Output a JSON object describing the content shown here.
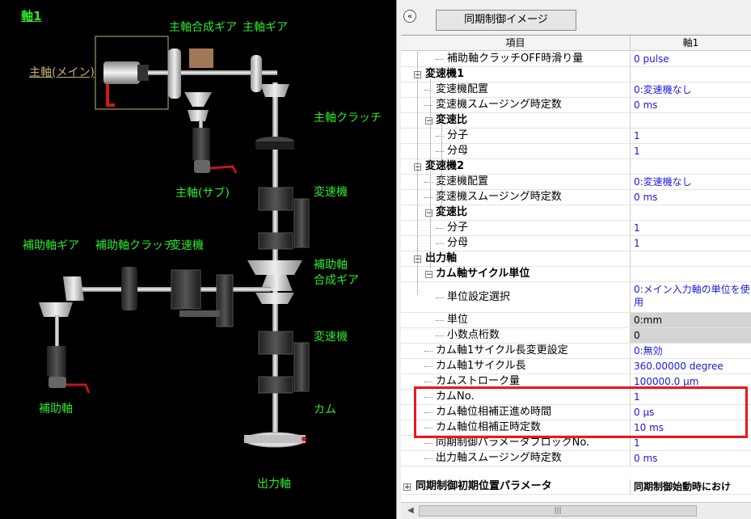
{
  "diagram": {
    "title": "軸1",
    "labels": {
      "main_shaft_main": "主軸(メイン)",
      "main_composite_gear": "主軸合成ギア",
      "main_shaft_gear": "主軸ギア",
      "main_clutch": "主軸クラッチ",
      "main_shaft_sub": "主軸(サブ)",
      "speed_changer_1": "変速機",
      "aux_gear": "補助軸ギア",
      "aux_clutch": "補助軸クラッチ",
      "aux_speed_changer": "変速機",
      "aux_composite_gear_1": "補助軸",
      "aux_composite_gear_2": "合成ギア",
      "speed_changer_2": "変速機",
      "aux_shaft": "補助軸",
      "cam": "カム",
      "output_shaft": "出力軸"
    }
  },
  "toolbar": {
    "collapse_icon": "«",
    "sync_button": "同期制御イメージ"
  },
  "table": {
    "header_item": "項目",
    "header_axis": "軸1",
    "rows": [
      {
        "label": "補助軸クラッチOFF時滑り量",
        "value": "0 pulse"
      },
      {
        "label": "変速機1",
        "value": ""
      },
      {
        "label": "変速機配置",
        "value": "0:変速機なし"
      },
      {
        "label": "変速機スムージング時定数",
        "value": "0 ms"
      },
      {
        "label": "変速比",
        "value": ""
      },
      {
        "label": "分子",
        "value": "1"
      },
      {
        "label": "分母",
        "value": "1"
      },
      {
        "label": "変速機2",
        "value": ""
      },
      {
        "label": "変速機配置",
        "value": "0:変速機なし"
      },
      {
        "label": "変速機スムージング時定数",
        "value": "0 ms"
      },
      {
        "label": "変速比",
        "value": ""
      },
      {
        "label": "分子",
        "value": "1"
      },
      {
        "label": "分母",
        "value": "1"
      },
      {
        "label": "出力軸",
        "value": ""
      },
      {
        "label": "カム軸サイクル単位",
        "value": ""
      },
      {
        "label": "単位設定選択",
        "value": "0:メイン入力軸の単位を使用"
      },
      {
        "label": "単位",
        "value": "0:mm"
      },
      {
        "label": "小数点桁数",
        "value": "0"
      },
      {
        "label": "カム軸1サイクル長変更設定",
        "value": "0:無効"
      },
      {
        "label": "カム軸1サイクル長",
        "value": "360.00000 degree"
      },
      {
        "label": "カムストローク量",
        "value": "100000.0 μm"
      },
      {
        "label": "カムNo.",
        "value": "1"
      },
      {
        "label": "カム軸位相補正進め時間",
        "value": "0 μs"
      },
      {
        "label": "カム軸位相補正時定数",
        "value": "10 ms"
      },
      {
        "label": "同期制御パラメータブロックNo.",
        "value": "1"
      },
      {
        "label": "出力軸スムージング時定数",
        "value": "0 ms"
      },
      {
        "label": "同期制御初期位置パラメータ",
        "value": "同期制御始動時におけ"
      }
    ]
  },
  "scrollbar": {
    "left_arrow": "◀",
    "thumb_grip": "|||"
  }
}
